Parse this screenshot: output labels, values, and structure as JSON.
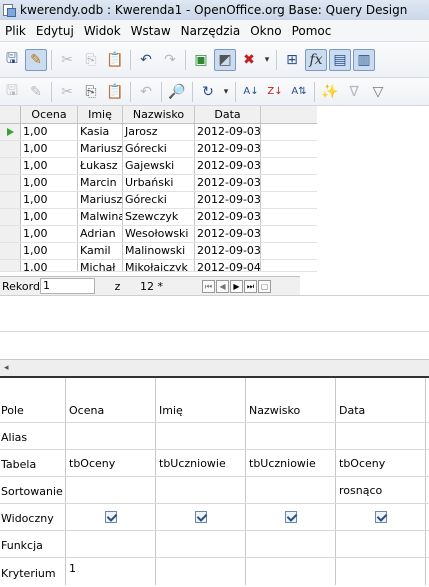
{
  "window": {
    "title": "kwerendy.odb : Kwerenda1 - OpenOffice.org Base: Query Design"
  },
  "menu": [
    "Plik",
    "Edytuj",
    "Widok",
    "Wstaw",
    "Narzędzia",
    "Okno",
    "Pomoc"
  ],
  "toolbar1": {
    "icons": [
      "save-icon",
      "edit-pencil-icon",
      "cut-icon",
      "copy-icon",
      "paste-icon",
      "undo-icon",
      "redo-icon",
      "run-query-icon",
      "toggle-design-icon",
      "clear-query-icon",
      "dropdown-arrow-icon",
      "add-table-icon",
      "functions-icon",
      "table-name-icon",
      "alias-icon"
    ]
  },
  "toolbar2": {
    "icons": [
      "save-record-icon",
      "edit-data-icon",
      "cut-icon",
      "copy-icon",
      "paste-icon",
      "undo-icon",
      "find-record-icon",
      "refresh-icon",
      "sort-ascending-icon",
      "sort-descending-icon",
      "sort-icon",
      "autofilter-icon",
      "apply-filter-icon",
      "filter-icon"
    ]
  },
  "results": {
    "columns": [
      "Ocena",
      "Imię",
      "Nazwisko",
      "Data"
    ],
    "rows": [
      [
        "1,00",
        "Kasia",
        "Jarosz",
        "2012-09-03"
      ],
      [
        "1,00",
        "Mariusz",
        "Górecki",
        "2012-09-03"
      ],
      [
        "1,00",
        "Łukasz",
        "Gajewski",
        "2012-09-03"
      ],
      [
        "1,00",
        "Marcin",
        "Urbański",
        "2012-09-03"
      ],
      [
        "1,00",
        "Mariusz",
        "Górecki",
        "2012-09-03"
      ],
      [
        "1,00",
        "Malwina",
        "Szewczyk",
        "2012-09-03"
      ],
      [
        "1,00",
        "Adrian",
        "Wesołowski",
        "2012-09-03"
      ],
      [
        "1,00",
        "Kamil",
        "Malinowski",
        "2012-09-03"
      ],
      [
        "1,00",
        "Michał",
        "Mikołajczyk",
        "2012-09-04"
      ]
    ]
  },
  "navigation": {
    "record_label": "Rekord",
    "record_value": "1",
    "of_label": "z",
    "total": "12 *"
  },
  "design": {
    "row_labels": [
      "Pole",
      "Alias",
      "Tabela",
      "Sortowanie",
      "Widoczny",
      "Funkcja",
      "Kryterium"
    ],
    "fields": [
      {
        "pole": "Ocena",
        "alias": "",
        "tabela": "tbOceny",
        "sortowanie": "",
        "widoczny": true,
        "funkcja": "",
        "kryterium": "1"
      },
      {
        "pole": "Imię",
        "alias": "",
        "tabela": "tbUczniowie",
        "sortowanie": "",
        "widoczny": true,
        "funkcja": "",
        "kryterium": ""
      },
      {
        "pole": "Nazwisko",
        "alias": "",
        "tabela": "tbUczniowie",
        "sortowanie": "",
        "widoczny": true,
        "funkcja": "",
        "kryterium": ""
      },
      {
        "pole": "Data",
        "alias": "",
        "tabela": "tbOceny",
        "sortowanie": "rosnąco",
        "widoczny": true,
        "funkcja": "",
        "kryterium": ""
      }
    ]
  }
}
